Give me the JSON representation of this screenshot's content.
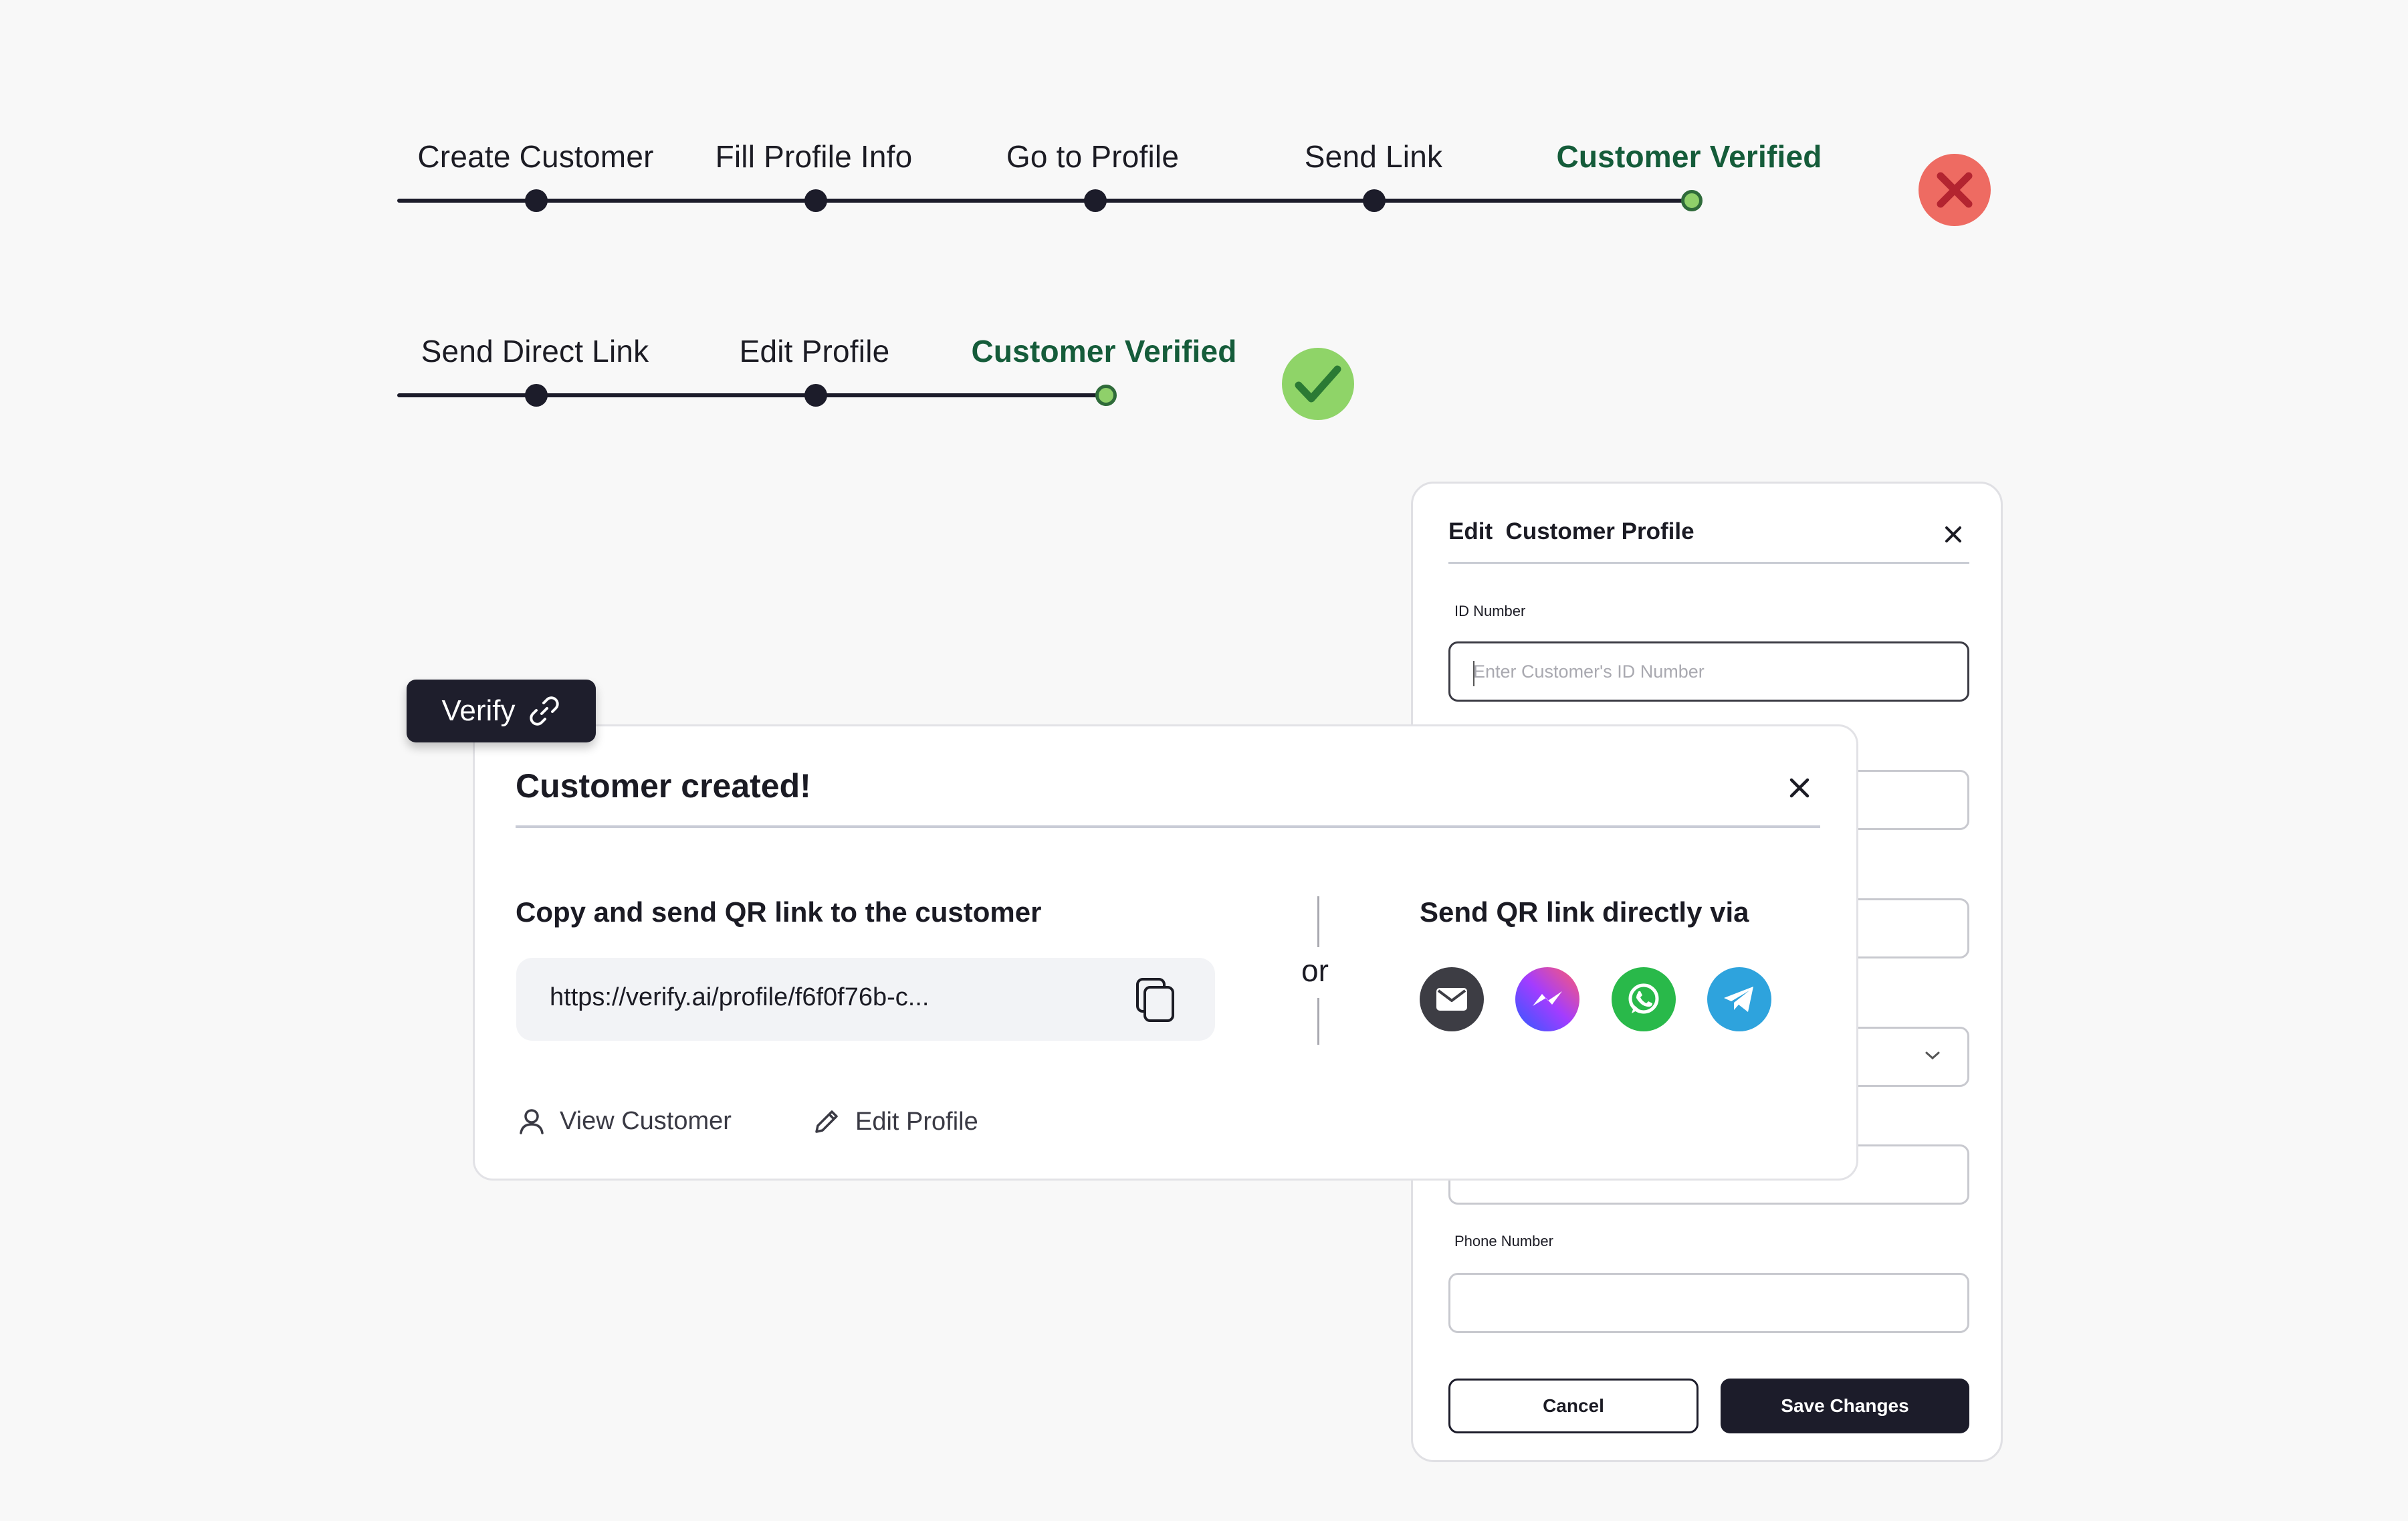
{
  "stepper_top": {
    "steps": [
      {
        "label": "Create Customer",
        "state": "complete"
      },
      {
        "label": "Fill Profile Info",
        "state": "complete"
      },
      {
        "label": "Go to Profile",
        "state": "complete"
      },
      {
        "label": "Send Link",
        "state": "complete"
      },
      {
        "label": "Customer Verified",
        "state": "verified"
      }
    ],
    "status": "failed"
  },
  "stepper_bottom": {
    "steps": [
      {
        "label": "Send Direct Link",
        "state": "complete"
      },
      {
        "label": "Edit Profile",
        "state": "complete"
      },
      {
        "label": "Customer Verified",
        "state": "verified"
      }
    ],
    "status": "success"
  },
  "edit_panel": {
    "title": "Edit  Customer Profile",
    "id_label": "ID Number",
    "id_placeholder": "Enter Customer's ID Number",
    "phone_label": "Phone Number",
    "cancel_label": "Cancel",
    "save_label": "Save Changes"
  },
  "verify_button": {
    "label": "Verify"
  },
  "modal": {
    "title": "Customer created!",
    "copy_heading": "Copy and send QR link to the customer",
    "link": "https://verify.ai/profile/f6f0f76b-c...",
    "or_text": "or",
    "direct_heading": "Send QR link directly via",
    "channels": [
      "email-icon",
      "messenger-icon",
      "whatsapp-icon",
      "telegram-icon"
    ],
    "view_customer_label": "View Customer",
    "edit_profile_label": "Edit Profile"
  },
  "colors": {
    "dark": "#1c1c2a",
    "verified_text": "#155c3a",
    "success": "#8fd468",
    "fail": "#ee6b62",
    "fail_mark": "#b32430",
    "success_mark": "#2b7a34"
  }
}
